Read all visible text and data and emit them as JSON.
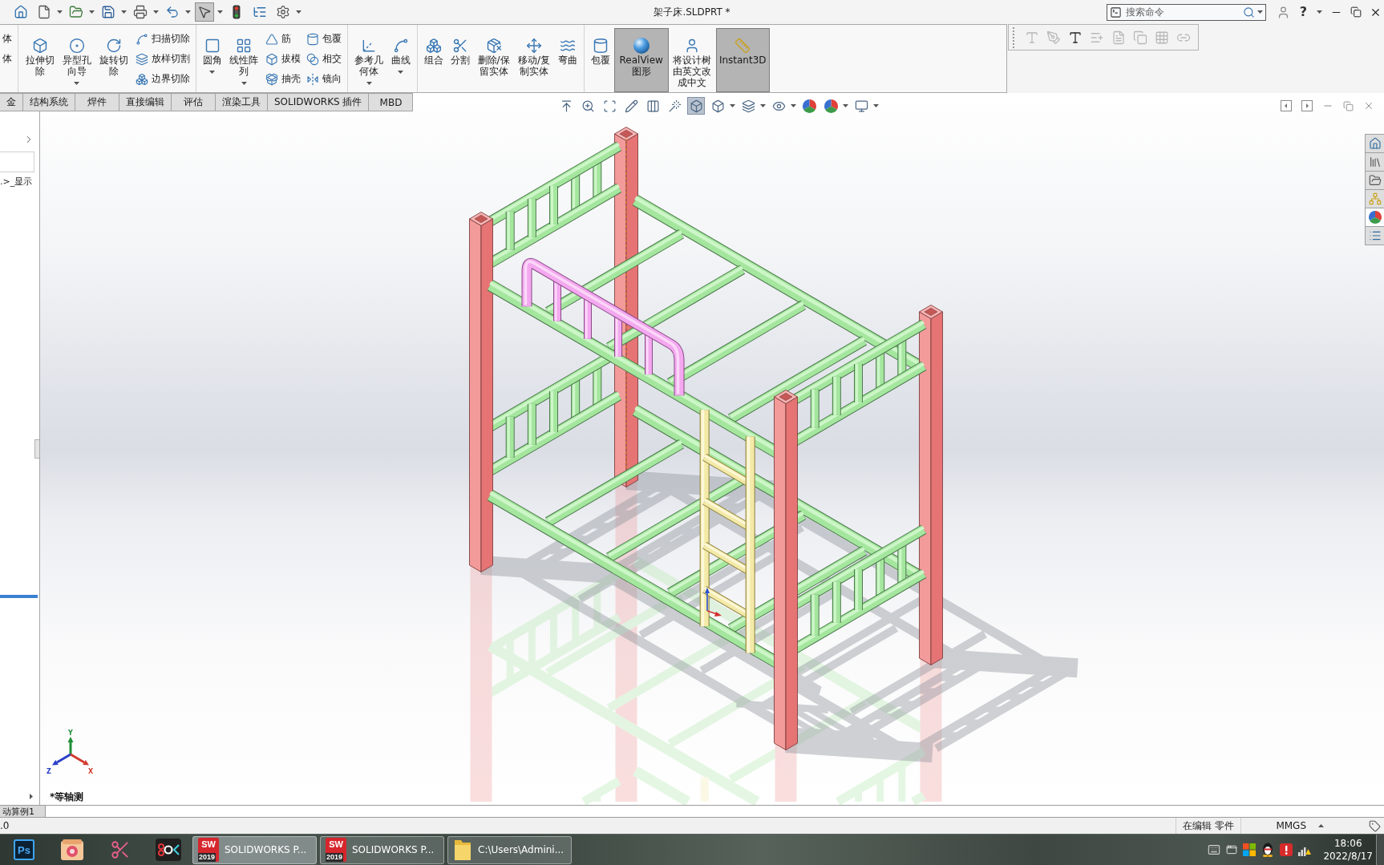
{
  "title_bar": {
    "quick_access": [
      {
        "on": false,
        "dropdown": false
      },
      {
        "on": false,
        "dropdown": true
      },
      {
        "on": false,
        "dropdown": true
      },
      {
        "on": false,
        "dropdown": true
      },
      {
        "on": false,
        "dropdown": true
      },
      {
        "on": false,
        "dropdown": true
      },
      {
        "on": true,
        "dropdown": true
      },
      {
        "on": false,
        "dropdown": false
      },
      {
        "on": false,
        "dropdown": false
      },
      {
        "on": false,
        "dropdown": true
      }
    ],
    "title": "架子床.SLDPRT *",
    "search": {
      "placeholder": "搜索命令"
    },
    "help": "?"
  },
  "ribbon": {
    "groups": [
      {
        "items": [
          {
            "kind": "stack",
            "entries": [
              {
                "label": "体"
              },
              {
                "label": "体"
              }
            ]
          }
        ]
      },
      {
        "items": [
          {
            "kind": "large",
            "label": "拉伸切除",
            "dropdown": false,
            "on": false
          },
          {
            "kind": "large",
            "label": "异型孔向导",
            "dropdown": true,
            "on": false
          },
          {
            "kind": "large",
            "label": "旋转切除",
            "dropdown": false,
            "on": false
          },
          {
            "kind": "stack",
            "entries": [
              {
                "label": "扫描切除"
              },
              {
                "label": "放样切割"
              },
              {
                "label": "边界切除"
              }
            ]
          }
        ]
      },
      {
        "items": [
          {
            "kind": "large",
            "label": "圆角",
            "dropdown": true,
            "on": false
          },
          {
            "kind": "large",
            "label": "线性阵列",
            "dropdown": true,
            "on": false
          },
          {
            "kind": "stack",
            "entries": [
              {
                "label": "筋"
              },
              {
                "label": "拔模"
              },
              {
                "label": "抽壳"
              }
            ]
          },
          {
            "kind": "stack",
            "entries": [
              {
                "label": "包覆"
              },
              {
                "label": "相交"
              },
              {
                "label": "镜向"
              }
            ]
          }
        ]
      },
      {
        "items": [
          {
            "kind": "large",
            "label": "参考几何体",
            "dropdown": true,
            "on": false
          },
          {
            "kind": "large",
            "label": "曲线",
            "dropdown": true,
            "on": false
          }
        ]
      },
      {
        "items": [
          {
            "kind": "large",
            "label": "组合",
            "dropdown": false,
            "on": false
          },
          {
            "kind": "large",
            "label": "分割",
            "dropdown": false,
            "on": false
          },
          {
            "kind": "large",
            "label": "删除/保留实体",
            "dropdown": false,
            "on": false
          },
          {
            "kind": "large",
            "label": "移动/复制实体",
            "dropdown": false,
            "on": false
          },
          {
            "kind": "large",
            "label": "弯曲",
            "dropdown": false,
            "on": false
          }
        ]
      },
      {
        "items": [
          {
            "kind": "large",
            "label": "包覆",
            "dropdown": false,
            "on": false
          },
          {
            "kind": "large",
            "label": "RealView图形",
            "dropdown": false,
            "on": true
          },
          {
            "kind": "large",
            "label": "将设计树由英文改成中文",
            "dropdown": false,
            "on": false
          },
          {
            "kind": "large",
            "label": "Instant3D",
            "dropdown": false,
            "on": true
          }
        ]
      }
    ]
  },
  "annotation_toolbar": [
    {
      "disabled": true
    },
    {
      "disabled": true
    },
    {
      "disabled": false
    },
    {
      "disabled": true
    },
    {
      "disabled": true
    },
    {
      "disabled": true
    },
    {
      "disabled": true
    },
    {
      "disabled": true
    }
  ],
  "command_tabs": [
    {
      "label": "金",
      "selected": false
    },
    {
      "label": "结构系统",
      "selected": false
    },
    {
      "label": "焊件",
      "selected": false
    },
    {
      "label": "直接编辑",
      "selected": false
    },
    {
      "label": "评估",
      "selected": false
    },
    {
      "label": "渲染工具",
      "selected": false
    },
    {
      "label": "SOLIDWORKS 插件",
      "selected": false
    },
    {
      "label": "MBD",
      "selected": false
    }
  ],
  "feature_tree": {
    "item": ".>_显示"
  },
  "view_toolbar": [
    {
      "on": false,
      "dropdown": false
    },
    {
      "on": false,
      "dropdown": false
    },
    {
      "on": false,
      "dropdown": false
    },
    {
      "on": false,
      "dropdown": false
    },
    {
      "on": false,
      "dropdown": false
    },
    {
      "on": false,
      "dropdown": false
    },
    {
      "on": true,
      "dropdown": false
    },
    {
      "on": false,
      "dropdown": true
    },
    {
      "on": false,
      "dropdown": true
    },
    {
      "on": false,
      "dropdown": true
    },
    {
      "on": false,
      "dropdown": false
    },
    {
      "on": false,
      "dropdown": true
    },
    {
      "on": false,
      "dropdown": true
    }
  ],
  "viewport": {
    "view_label": "*等轴测",
    "triad": {
      "x": "X",
      "y": "Y",
      "z": "Z"
    }
  },
  "task_pane_tabs": [
    {
      "selected": false
    },
    {
      "selected": false
    },
    {
      "selected": false
    },
    {
      "selected": false
    },
    {
      "selected": true
    },
    {
      "selected": false
    }
  ],
  "bottom_tabs": [
    {
      "label": "动算例1",
      "selected": false
    }
  ],
  "status_bar": {
    "message": ".0",
    "mode": "在编辑 零件",
    "units": "MMGS"
  },
  "taskbar": {
    "pinned_icon_text": "Ps",
    "windows": [
      {
        "label": "SOLIDWORKS P...",
        "logo": "SW",
        "badge": "2019",
        "selected": true
      },
      {
        "label": "SOLIDWORKS P...",
        "logo": "SW",
        "badge": "2019",
        "selected": false
      },
      {
        "label": "C:\\Users\\Admini...",
        "selected": false
      }
    ],
    "clock": {
      "time": "18:06",
      "date": "2022/8/17"
    }
  }
}
